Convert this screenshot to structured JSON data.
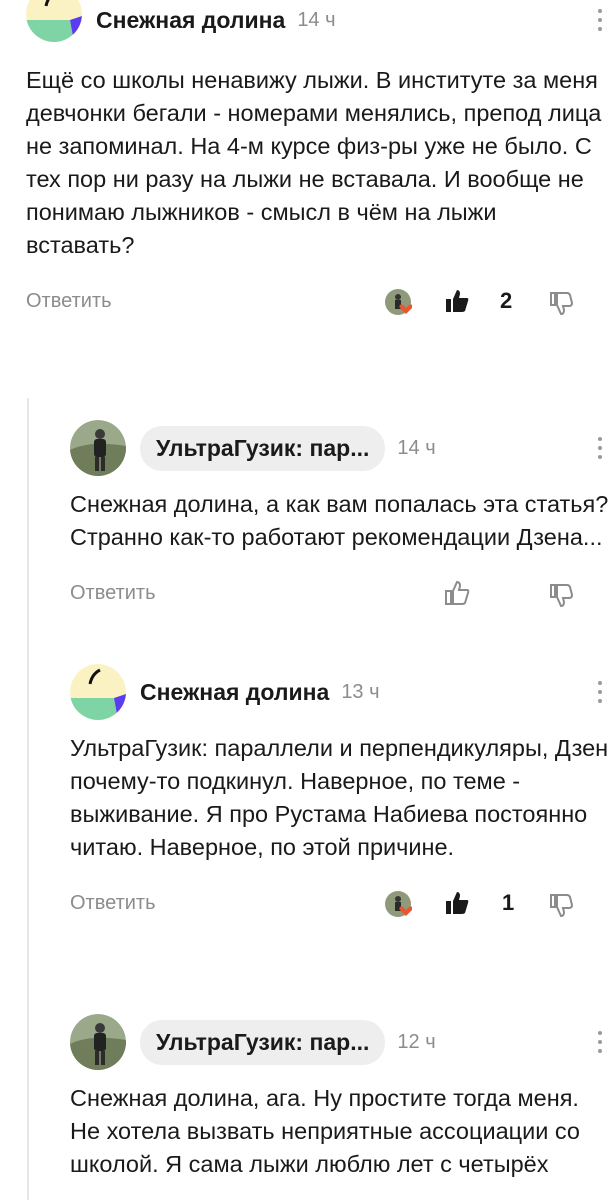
{
  "comments": [
    {
      "author": "Снежная долина",
      "time": "14 ч",
      "text": "Ещё со школы ненавижу лыжи. В институте за меня девчонки бегали - номерами менялись, препод лица не запоминал. На 4-м курсе физ-ры уже не было. С тех пор ни разу на лыжи не вставала. И вообще не понимаю лыжников - смысл в чём на лыжи вставать?",
      "reply_label": "Ответить",
      "likes": "2"
    },
    {
      "author": "УльтраГузик: пар...",
      "time": "14 ч",
      "text": "Снежная долина, а как вам попалась эта статья? Странно как-то работают рекомендации Дзена...",
      "reply_label": "Ответить"
    },
    {
      "author": "Снежная долина",
      "time": "13 ч",
      "text": "УльтраГузик: параллели и перпендикуляры, Дзен почему-то подкинул. Наверное, по теме - выживание. Я про Рустама Набиева постоянно читаю. Наверное, по этой причине.",
      "reply_label": "Ответить",
      "likes": "1"
    },
    {
      "author": "УльтраГузик: пар...",
      "time": "12 ч",
      "text": "Снежная долина, ага. Ну простите тогда меня. Не хотела вызвать неприятные ассоциации со школой. Я сама лыжи люблю лет с четырёх"
    }
  ],
  "icons": {
    "snow_avatar": "abstract-logo-avatar",
    "ultra_avatar": "runner-photo-avatar",
    "like": "thumbs-up-icon",
    "dislike": "thumbs-down-icon",
    "more": "more-vertical-icon"
  },
  "colors": {
    "like_heart": "#e8552f",
    "avatar_green": "#7fd4a6",
    "avatar_purple": "#5b3df0",
    "avatar_yellow": "#fbf2c4"
  }
}
